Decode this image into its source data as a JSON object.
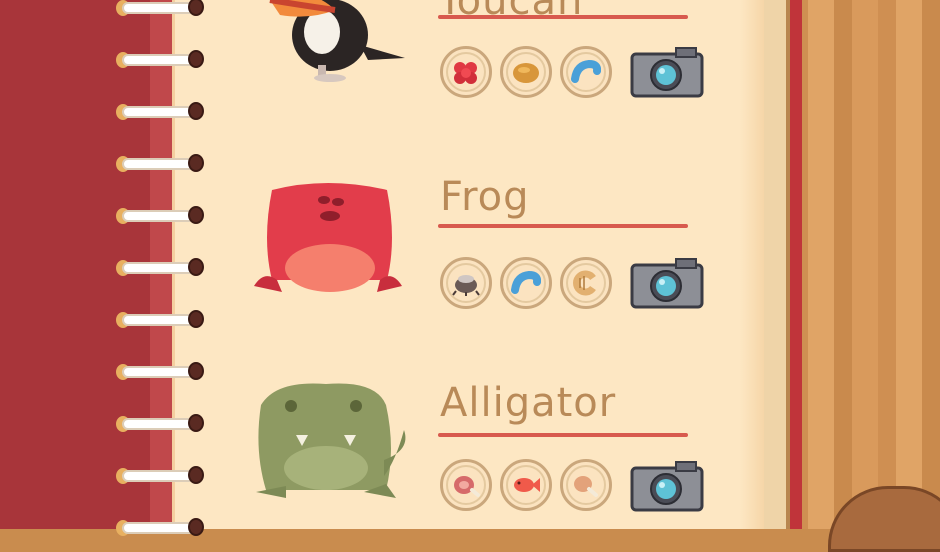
{
  "notebook": {
    "entries": [
      {
        "name": "Toucan",
        "foods": [
          "berries-icon",
          "nut-icon",
          "worm-icon"
        ],
        "camera": "camera-icon"
      },
      {
        "name": "Frog",
        "foods": [
          "beetle-icon",
          "worm-icon",
          "grub-icon"
        ],
        "camera": "camera-icon"
      },
      {
        "name": "Alligator",
        "foods": [
          "meat-icon",
          "fish-icon",
          "drumstick-icon"
        ],
        "camera": "camera-icon"
      }
    ]
  },
  "colors": {
    "cover": "#a8353a",
    "page": "#fde7c3",
    "title": "#b98a58",
    "underline": "#d85a4e"
  }
}
